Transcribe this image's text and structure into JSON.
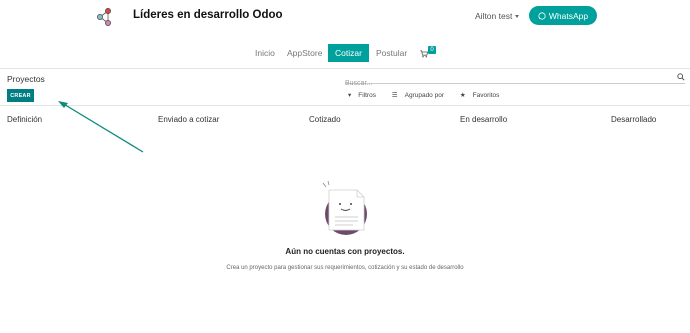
{
  "header": {
    "brand": "Líderes en desarrollo Odoo",
    "user": "Ailton test",
    "whatsapp_label": "WhatsApp"
  },
  "nav": {
    "items": [
      "Inicio",
      "AppStore",
      "Cotizar",
      "Postular"
    ],
    "active": "Cotizar",
    "cart_count": "0"
  },
  "control_panel": {
    "title": "Proyectos",
    "create_label": "CREAR",
    "search_placeholder": "Buscar...",
    "filters_label": "Filtros",
    "groupby_label": "Agrupado por",
    "favorites_label": "Favoritos"
  },
  "columns": [
    "Definición",
    "Enviado a cotizar",
    "Cotizado",
    "En desarrollo",
    "Desarrollado"
  ],
  "empty_state": {
    "title": "Aún no cuentas con proyectos.",
    "text": "Crea un proyecto para gestionar sus requerimientos, cotización y su estado de desarrollo"
  },
  "colors": {
    "primary": "#00a09d",
    "create_button": "#017e84",
    "annotation_arrow": "#0e8a7e"
  }
}
